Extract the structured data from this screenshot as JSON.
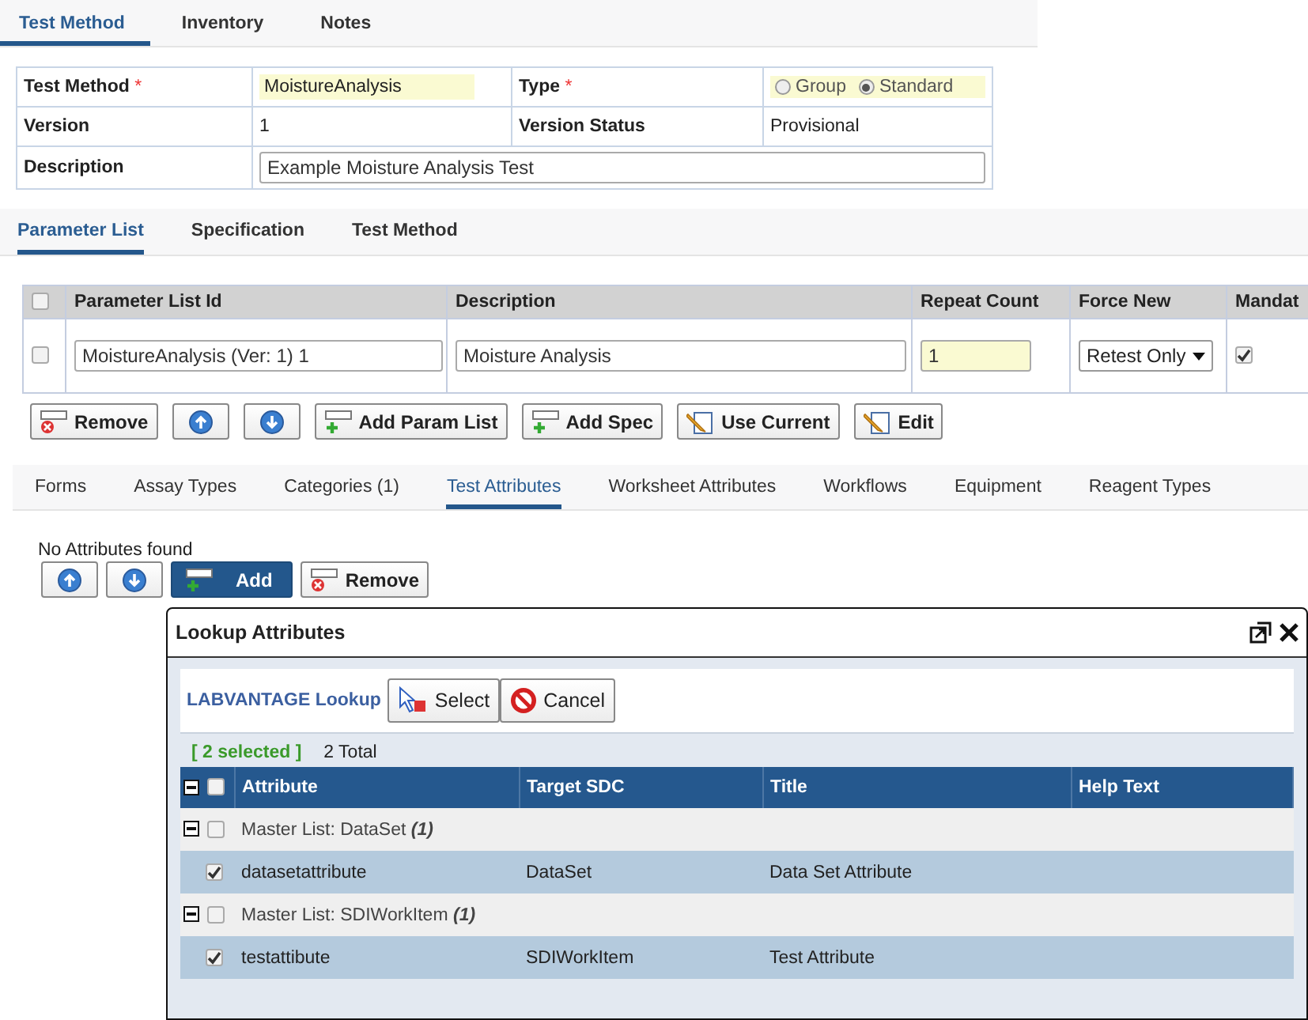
{
  "top_tabs": [
    {
      "label": "Test Method",
      "selected": true
    },
    {
      "label": "Inventory",
      "selected": false
    },
    {
      "label": "Notes",
      "selected": false
    }
  ],
  "form": {
    "test_method": {
      "label": "Test Method",
      "required_mark": "*",
      "value": "MoistureAnalysis"
    },
    "type": {
      "label": "Type",
      "required_mark": "*",
      "options": [
        {
          "label": "Group",
          "selected": false
        },
        {
          "label": "Standard",
          "selected": true
        }
      ]
    },
    "version": {
      "label": "Version",
      "value": "1"
    },
    "version_status": {
      "label": "Version Status",
      "value": "Provisional"
    },
    "description": {
      "label": "Description",
      "value": "Example Moisture Analysis Test"
    }
  },
  "param_tabs": [
    {
      "label": "Parameter List",
      "selected": true
    },
    {
      "label": "Specification",
      "selected": false
    },
    {
      "label": "Test Method",
      "selected": false
    }
  ],
  "param_table": {
    "all_checked": false,
    "columns": [
      "Parameter List Id",
      "Description",
      "Repeat Count",
      "Force New",
      "Mandat"
    ],
    "rows": [
      {
        "checked": false,
        "id": "MoistureAnalysis (Ver: 1) 1",
        "description": "Moisture Analysis",
        "repeat_count": "1",
        "force_new": "Retest Only",
        "mandatory": true
      }
    ]
  },
  "param_buttons": [
    {
      "kind": "remove",
      "label": "Remove"
    },
    {
      "kind": "up"
    },
    {
      "kind": "down"
    },
    {
      "kind": "add",
      "label": "Add Param List"
    },
    {
      "kind": "add",
      "label": "Add Spec"
    },
    {
      "kind": "edit",
      "label": "Use Current"
    },
    {
      "kind": "edit",
      "label": "Edit"
    }
  ],
  "detail_tabs": [
    {
      "label": "Forms",
      "selected": false
    },
    {
      "label": "Assay Types",
      "selected": false
    },
    {
      "label": "Categories (1)",
      "selected": false
    },
    {
      "label": "Test Attributes",
      "selected": true
    },
    {
      "label": "Worksheet Attributes",
      "selected": false
    },
    {
      "label": "Workflows",
      "selected": false
    },
    {
      "label": "Equipment",
      "selected": false
    },
    {
      "label": "Reagent Types",
      "selected": false
    }
  ],
  "attributes_message": "No Attributes found",
  "attribute_buttons": [
    {
      "kind": "up",
      "primary": false
    },
    {
      "kind": "down",
      "primary": false
    },
    {
      "kind": "add",
      "label": "Add",
      "primary": true
    },
    {
      "kind": "remove",
      "label": "Remove",
      "primary": false
    }
  ],
  "dialog": {
    "title": "Lookup Attributes",
    "lookup_label": "LABVANTAGE Lookup",
    "buttons": [
      {
        "kind": "select",
        "label": "Select"
      },
      {
        "kind": "cancel",
        "label": "Cancel"
      }
    ],
    "selected_count": "[ 2 selected ]",
    "total": "2 Total",
    "all_checked": false,
    "columns": [
      "Attribute",
      "Target SDC",
      "Title",
      "Help Text"
    ],
    "groups": [
      {
        "label": "Master List: DataSet",
        "count": "(1)",
        "expanded": true,
        "checked": false,
        "rows": [
          {
            "checked": true,
            "attribute": "datasetattribute",
            "target_sdc": "DataSet",
            "title": "Data Set Attribute"
          }
        ]
      },
      {
        "label": "Master List: SDIWorkItem",
        "count": "(1)",
        "expanded": true,
        "checked": false,
        "rows": [
          {
            "checked": true,
            "attribute": "testattibute",
            "target_sdc": "SDIWorkItem",
            "title": "Test Attribute"
          }
        ]
      }
    ]
  }
}
